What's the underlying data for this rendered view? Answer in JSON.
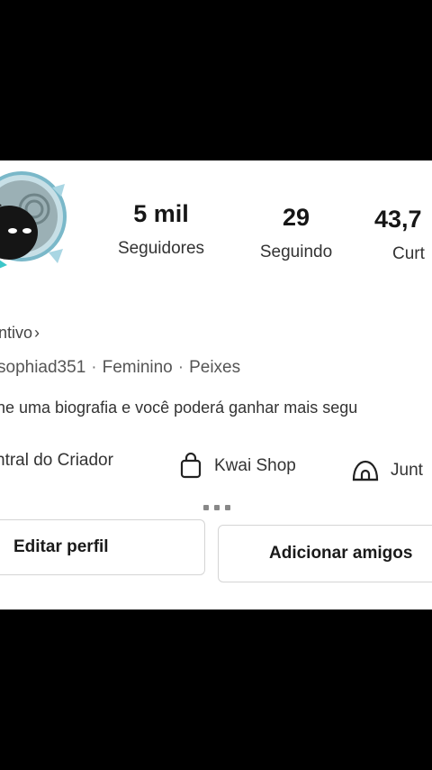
{
  "profile": {
    "stats": [
      {
        "value": "5 mil",
        "label": "Seguidores"
      },
      {
        "value": "29",
        "label": "Seguindo"
      },
      {
        "value": "43,7",
        "label": "Curt"
      }
    ],
    "incentive_link": "ntivo",
    "incentive_chevron": "›",
    "username": "sophiad351",
    "gender": "Feminino",
    "sign": "Peixes",
    "separator": "·",
    "bio_prompt": "ne uma biografia e você poderá ganhar mais segu"
  },
  "tools": [
    {
      "label": "ntral do Criador",
      "icon": "none"
    },
    {
      "label": "Kwai Shop",
      "icon": "shopping-bag-icon"
    },
    {
      "label": "Junt",
      "icon": "dome-icon"
    }
  ],
  "buttons": {
    "edit_profile": "Editar perfil",
    "add_friends": "Adicionar amigos"
  },
  "colors": {
    "background": "#000000",
    "panel": "#ffffff",
    "button_border": "#d5d5d5",
    "avatar_frame": "#7ab8c9"
  }
}
